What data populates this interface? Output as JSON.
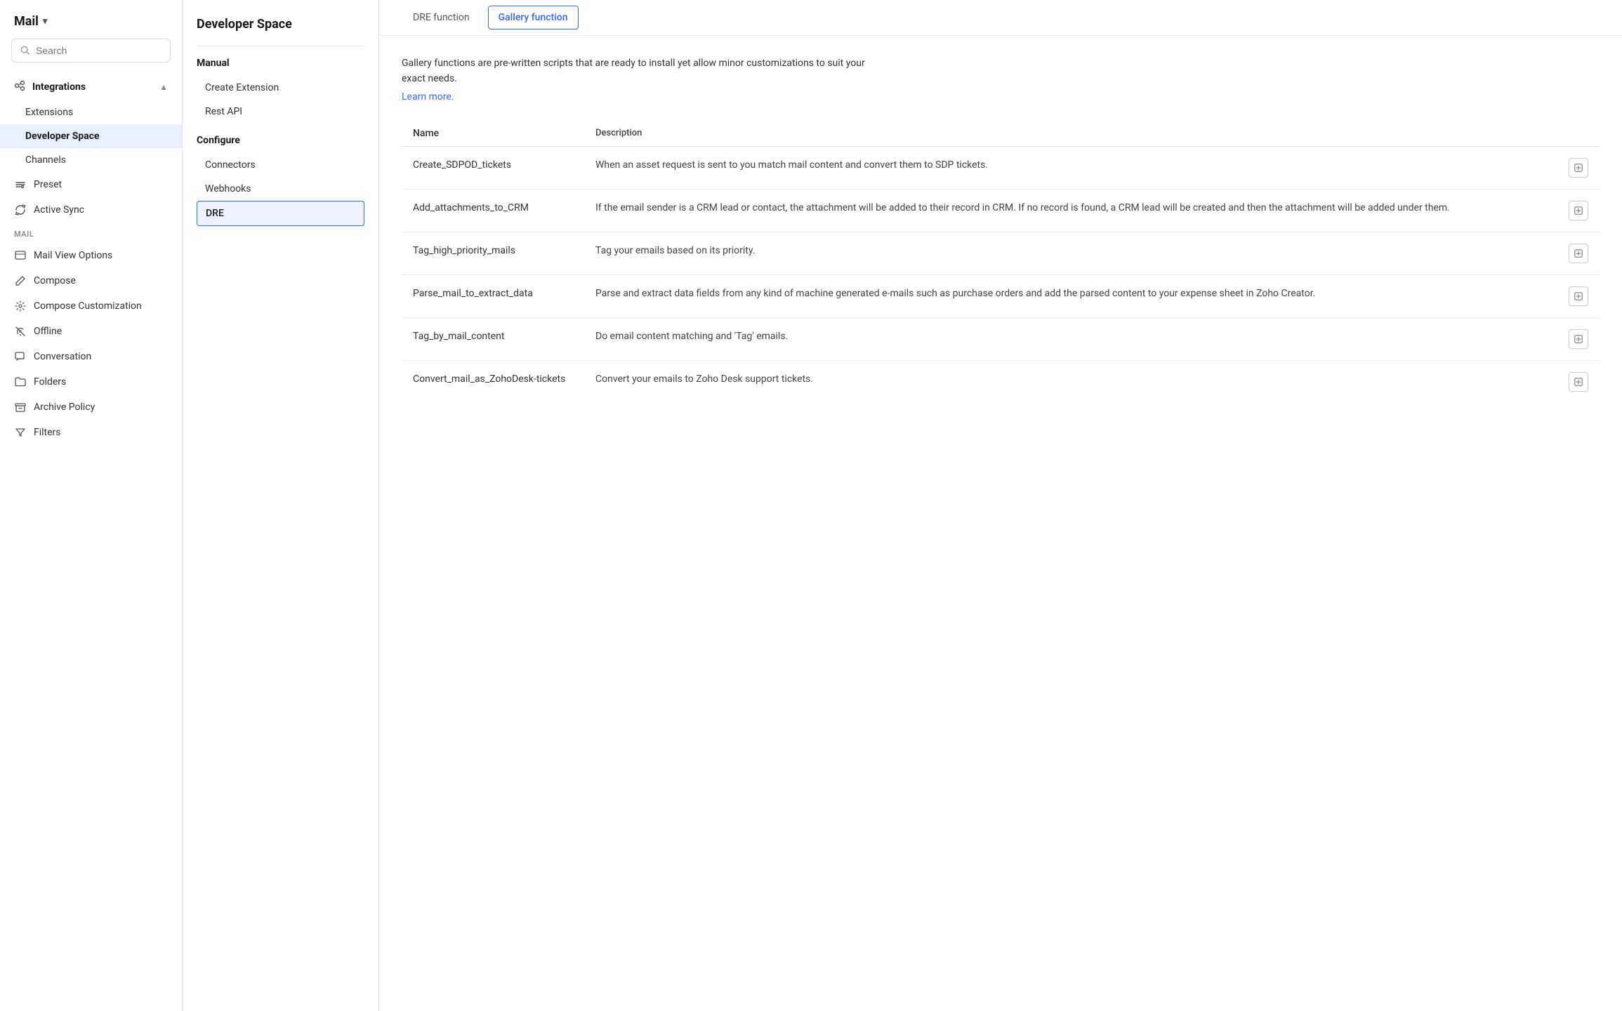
{
  "app": {
    "title": "Mail",
    "title_chevron": "▾"
  },
  "search": {
    "placeholder": "Search"
  },
  "left_nav": {
    "integrations_label": "Integrations",
    "integrations_items": [
      {
        "id": "extensions",
        "label": "Extensions"
      },
      {
        "id": "developer-space",
        "label": "Developer Space",
        "active": true
      },
      {
        "id": "channels",
        "label": "Channels"
      }
    ],
    "preset_label": "Preset",
    "active_sync_label": "Active Sync",
    "mail_section": "MAIL",
    "mail_items": [
      {
        "id": "mail-view-options",
        "label": "Mail View Options"
      },
      {
        "id": "compose",
        "label": "Compose"
      },
      {
        "id": "compose-customization",
        "label": "Compose Customization"
      },
      {
        "id": "offline",
        "label": "Offline"
      },
      {
        "id": "conversation",
        "label": "Conversation"
      },
      {
        "id": "folders",
        "label": "Folders"
      },
      {
        "id": "archive-policy",
        "label": "Archive Policy"
      },
      {
        "id": "filters",
        "label": "Filters"
      }
    ]
  },
  "middle_panel": {
    "title": "Developer Space",
    "manual_section": "Manual",
    "manual_items": [
      {
        "id": "create-extension",
        "label": "Create Extension"
      },
      {
        "id": "rest-api",
        "label": "Rest API"
      }
    ],
    "configure_section": "Configure",
    "configure_items": [
      {
        "id": "connectors",
        "label": "Connectors"
      },
      {
        "id": "webhooks",
        "label": "Webhooks"
      },
      {
        "id": "dre",
        "label": "DRE",
        "active": true
      }
    ]
  },
  "main": {
    "tabs": [
      {
        "id": "dre-function",
        "label": "DRE function",
        "active": false
      },
      {
        "id": "gallery-function",
        "label": "Gallery function",
        "active": true,
        "boxed": true
      }
    ],
    "description": "Gallery functions are pre-written scripts that are ready to install yet allow minor customizations to suit your exact needs.",
    "learn_more": "Learn more.",
    "table": {
      "headers": [
        "Name",
        "Description"
      ],
      "rows": [
        {
          "name": "Create_SDPOD_tickets",
          "description": "When an asset request is sent to you match mail content and convert them to SDP tickets."
        },
        {
          "name": "Add_attachments_to_CRM",
          "description": "If the email sender is a CRM lead or contact, the attachment will be added to their record in CRM. If no record is found, a CRM lead will be created and then the attachment will be added under them."
        },
        {
          "name": "Tag_high_priority_mails",
          "description": "Tag your emails based on its priority."
        },
        {
          "name": "Parse_mail_to_extract_data",
          "description": "Parse and extract data fields from any kind of machine generated e-mails such as purchase orders and add the parsed content to your expense sheet in Zoho Creator."
        },
        {
          "name": "Tag_by_mail_content",
          "description": "Do email content matching and 'Tag' emails."
        },
        {
          "name": "Convert_mail_as_ZohoDesk-tickets",
          "description": "Convert your emails to Zoho Desk support tickets."
        }
      ]
    }
  }
}
